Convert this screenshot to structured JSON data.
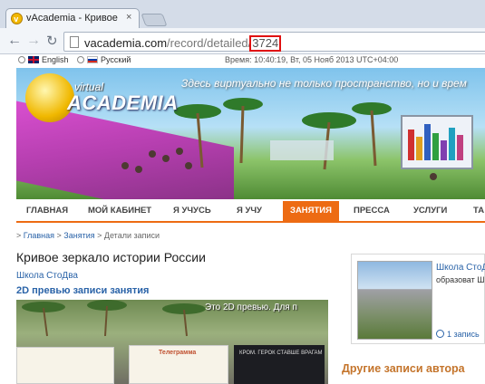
{
  "browser": {
    "tab_title": "vAcademia - Кривое зерка",
    "tab_close": "×",
    "url_prefix": "vacademia.com",
    "url_path": "/record/detailed/",
    "url_id": "3724"
  },
  "site": {
    "lang_en": "English",
    "lang_ru": "Русский",
    "server_time": "Время: 10:40:19, Вт, 05 Нояб 2013 UTC+04:00",
    "logo_virtual": "virtual",
    "logo_academia": "ACADEMIA",
    "slogan": "Здесь виртуально не только пространство, но и врем"
  },
  "nav": {
    "items": [
      {
        "label": "ГЛАВНАЯ"
      },
      {
        "label": "МОЙ КАБИНЕТ"
      },
      {
        "label": "Я УЧУСЬ"
      },
      {
        "label": "Я УЧУ"
      },
      {
        "label": "ЗАНЯТИЯ"
      },
      {
        "label": "ПРЕССА"
      },
      {
        "label": "УСЛУГИ"
      },
      {
        "label": "ТА"
      }
    ],
    "active_index": 4
  },
  "breadcrumb": {
    "prefix": "> ",
    "home": "Главная",
    "sep": " > ",
    "section": "Занятия",
    "current": "Детали записи"
  },
  "record": {
    "title": "Кривое зеркало истории России",
    "school": "Школа СтоДва",
    "preview_heading": "2D превью записи занятия",
    "preview_caption": "Это 2D превью. Для п",
    "doc_left_title": "Телеграмма",
    "doc_right_text": "КРОМ. ГЕРОК СТАВШЕ ВРАГАМ"
  },
  "sidebar": {
    "school_name": "Школа СтоД",
    "school_desc": "образоват Школа углу английский литературу предметы ( нравится: С",
    "records_count": "1 запись",
    "other_records_title": "Другие записи автора"
  },
  "colors": {
    "accent": "#ed6b13",
    "link": "#2a63a8",
    "highlight_box": "#e01010"
  }
}
